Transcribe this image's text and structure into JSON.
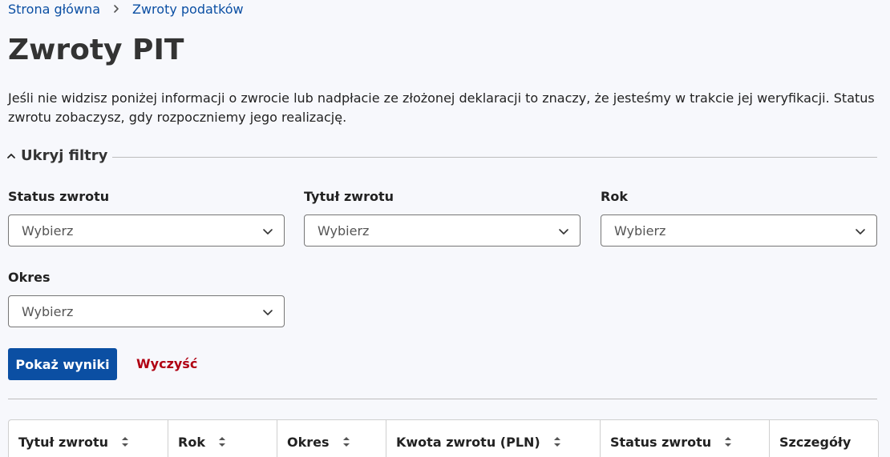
{
  "breadcrumb": {
    "items": [
      "Strona główna",
      "Zwroty podatków"
    ]
  },
  "page": {
    "title": "Zwroty PIT",
    "intro": "Jeśli nie widzisz poniżej informacji o zwrocie lub nadpłacie ze złożonej deklaracji to znaczy, że jesteśmy w trakcie jej weryfikacji. Status zwrotu zobaczysz, gdy rozpoczniemy jego realizację."
  },
  "filters": {
    "toggle_label": "Ukryj filtry",
    "fields": [
      {
        "label": "Status zwrotu",
        "value": "Wybierz"
      },
      {
        "label": "Tytuł zwrotu",
        "value": "Wybierz"
      },
      {
        "label": "Rok",
        "value": "Wybierz"
      },
      {
        "label": "Okres",
        "value": "Wybierz"
      }
    ],
    "submit_label": "Pokaż wyniki",
    "clear_label": "Wyczyść"
  },
  "table": {
    "headers": [
      "Tytuł zwrotu",
      "Rok",
      "Okres",
      "Kwota zwrotu (PLN)",
      "Status zwrotu",
      "Szczegóły"
    ]
  },
  "colors": {
    "primary": "#0b4fa3",
    "danger": "#b00012",
    "background": "#f7f8fc"
  },
  "icons": {
    "breadcrumb_separator": "chevron-right-icon",
    "filter_toggle": "chevron-up-icon",
    "select": "chevron-down-icon",
    "sort": "sort-icon"
  }
}
